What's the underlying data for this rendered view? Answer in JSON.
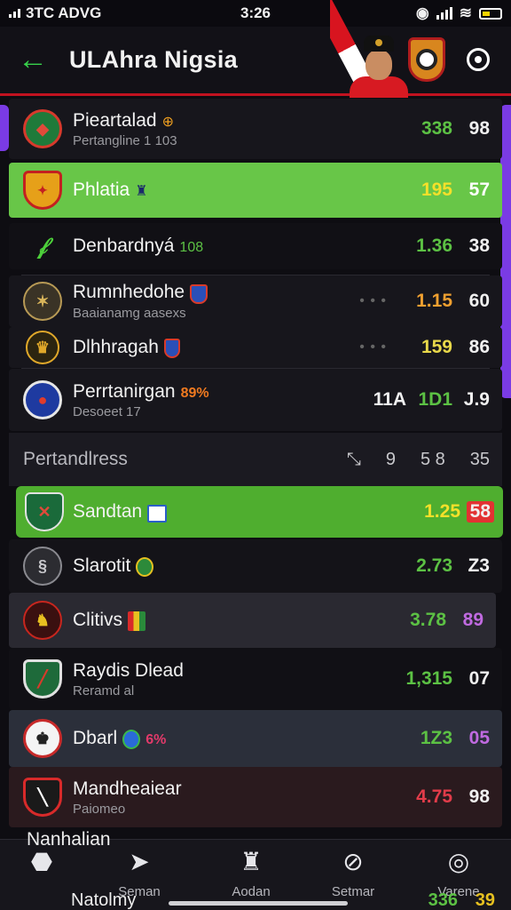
{
  "status_bar": {
    "carrier": "3TC ADVG",
    "time": "3:26"
  },
  "header": {
    "title": "ULAhra Nigsia"
  },
  "colors": {
    "accent_green": "#5cc144",
    "highlight_green": "#4fae2f",
    "alert_red": "#e23232",
    "purple_accent": "#7a3be4",
    "header_underline": "#c1121f"
  },
  "rows_top": [
    {
      "name": "Pieartalad",
      "tag": "⊕",
      "sub": "Pertangline 1 103",
      "v1": "338",
      "v2": "98",
      "v1_color": "#5cc144",
      "icon": "club-crest-icon"
    },
    {
      "name": "Phlatia",
      "tag": "♜",
      "sub": "",
      "v1": "195",
      "v2": "57",
      "v1_color": "#f5e02a",
      "icon": "club-shield-icon",
      "highlight": true
    },
    {
      "name": "Denbardnyá",
      "tag": "108",
      "sub": "",
      "v1": "1.36",
      "v2": "38",
      "v1_color": "#5cc144",
      "icon": "club-mark-icon"
    },
    {
      "name": "Rumnhedohe",
      "tag": "",
      "sub": "Baaianamg aasexs",
      "dots": "• • •",
      "v1": "1.15",
      "v2": "60",
      "v1_color": "#f0a030",
      "icon": "eagle-crest-icon"
    },
    {
      "name": "Dlhhragah",
      "tag": "",
      "sub": "",
      "dots": "• • •",
      "v1": "159",
      "v2": "86",
      "v1_color": "#e8d84a",
      "icon": "crown-crest-icon"
    },
    {
      "name": "Perrtanirgan",
      "tag": "89%",
      "sub": "Desoeet 17",
      "v0": "11A",
      "v1": "1D1",
      "v2": "J.9",
      "v1_color": "#5cc144",
      "icon": "round-crest-icon"
    }
  ],
  "section": {
    "label": "Pertandlress",
    "cols": [
      "⤡",
      "9",
      "5 8",
      "35"
    ]
  },
  "rows_bottom": [
    {
      "name": "Sandtan",
      "tag": "",
      "sub": "",
      "v1": "1.25",
      "v2": "58",
      "v1_color": "#f5e02a",
      "v2_badge": true,
      "icon": "green-shield-icon",
      "highlight": true
    },
    {
      "name": "Slarotit",
      "tag": "",
      "sub": "",
      "v1": "2.73",
      "v2": "Z3",
      "v1_color": "#5cc144",
      "icon": "grey-crest-icon"
    },
    {
      "name": "Clitivs",
      "tag": "",
      "sub": "",
      "v1": "3.78",
      "v2": "89",
      "v1_color": "#5cc144",
      "v2_color": "#c06ae0",
      "icon": "lion-crest-icon"
    },
    {
      "name": "Raydis Dlead",
      "tag": "",
      "sub": "Reramd al",
      "v1": "1,315",
      "v2": "07",
      "v1_color": "#5cc144",
      "icon": "sash-shield-icon"
    },
    {
      "name": "Dbarl",
      "tag": "6%",
      "sub": "",
      "v1": "1Z3",
      "v2": "05",
      "v1_color": "#5cc144",
      "v2_color": "#c06ae0",
      "icon": "warrior-crest-icon"
    },
    {
      "name": "Mandheaiear",
      "tag": "",
      "sub": "Paiomeo",
      "v1": "4.75",
      "v2": "98",
      "v1_color": "#e23c4a",
      "icon": "red-shield-icon"
    }
  ],
  "peek_rows": [
    {
      "name": "Nanhalian"
    },
    {
      "name": "Natolmy",
      "v1": "336",
      "v2": "39"
    }
  ],
  "bottom_nav": [
    {
      "label": "",
      "icon": "shoe-icon"
    },
    {
      "label": "Seman",
      "icon": "send-icon"
    },
    {
      "label": "Aodan",
      "icon": "trophy-icon"
    },
    {
      "label": "Setmar",
      "icon": "ball-icon"
    },
    {
      "label": "Varene",
      "icon": "settings-icon"
    }
  ]
}
